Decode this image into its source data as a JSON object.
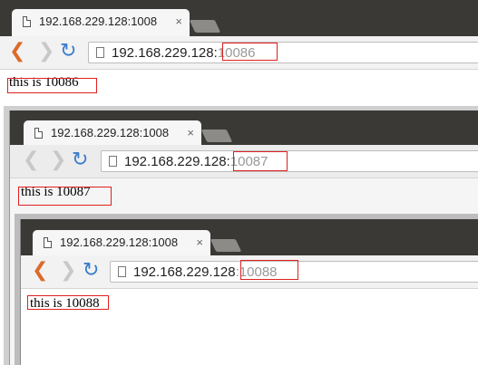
{
  "windows": [
    {
      "tab_title": "192.168.229.128:1008",
      "close": "×",
      "url_host": "192.168.229.128:",
      "url_port": "10086",
      "page_text": "this is 10086"
    },
    {
      "tab_title": "192.168.229.128:1008",
      "close": "×",
      "url_host": "192.168.229.128:",
      "url_port": "10087",
      "page_text": "this is 10087"
    },
    {
      "tab_title": "192.168.229.128:1008",
      "close": "×",
      "url_host": "192.168.229.128",
      "url_port": ":10088",
      "page_text": "this is 10088"
    }
  ],
  "icons": {
    "back": "❮",
    "forward": "❯",
    "reload": "↻"
  },
  "colors": {
    "frame": "#3a3936",
    "highlight_box": "#e02020",
    "back_active": "#dc6a2b",
    "reload": "#3a7ccc"
  }
}
